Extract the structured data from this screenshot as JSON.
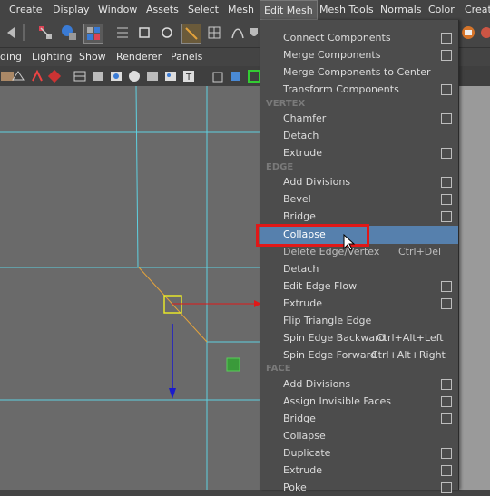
{
  "menubar": {
    "items": [
      {
        "label": "Create"
      },
      {
        "label": "Display"
      },
      {
        "label": "Window"
      },
      {
        "label": "Assets"
      },
      {
        "label": "Select"
      },
      {
        "label": "Mesh"
      },
      {
        "label": "Edit Mesh"
      },
      {
        "label": "Mesh Tools"
      },
      {
        "label": "Normals"
      },
      {
        "label": "Color"
      },
      {
        "label": "Creat"
      }
    ]
  },
  "panel_menu": {
    "items": [
      {
        "label": "ding"
      },
      {
        "label": "Lighting"
      },
      {
        "label": "Show"
      },
      {
        "label": "Renderer"
      },
      {
        "label": "Panels"
      }
    ]
  },
  "dropdown": {
    "top_items": [
      {
        "label": "Connect Components",
        "box": true
      },
      {
        "label": "Merge Components",
        "box": true
      },
      {
        "label": "Merge Components to Center",
        "box": false
      },
      {
        "label": "Transform Components",
        "box": true
      }
    ],
    "sections": {
      "vertex": "VERTEX",
      "edge": "EDGE",
      "face": "FACE"
    },
    "vertex_items": [
      {
        "label": "Chamfer",
        "box": true
      },
      {
        "label": "Detach",
        "box": false
      },
      {
        "label": "Extrude",
        "box": true
      }
    ],
    "edge_items": [
      {
        "label": "Add Divisions",
        "box": true
      },
      {
        "label": "Bevel",
        "box": true
      },
      {
        "label": "Bridge",
        "box": true
      },
      {
        "label": "Collapse",
        "box": false,
        "highlighted": true
      },
      {
        "label": "Delete Edge/Vertex",
        "shortcut": "Ctrl+Del",
        "box": false
      },
      {
        "label": "Detach",
        "box": false
      },
      {
        "label": "Edit Edge Flow",
        "box": true
      },
      {
        "label": "Extrude",
        "box": true
      },
      {
        "label": "Flip Triangle Edge",
        "box": false
      },
      {
        "label": "Spin Edge Backward",
        "shortcut": "Ctrl+Alt+Left",
        "box": false
      },
      {
        "label": "Spin Edge Forward",
        "shortcut": "Ctrl+Alt+Right",
        "box": false
      }
    ],
    "face_items": [
      {
        "label": "Add Divisions",
        "box": true
      },
      {
        "label": "Assign Invisible Faces",
        "box": true
      },
      {
        "label": "Bridge",
        "box": true
      },
      {
        "label": "Collapse",
        "box": false
      },
      {
        "label": "Duplicate",
        "box": true
      },
      {
        "label": "Extrude",
        "box": true
      },
      {
        "label": "Poke",
        "box": true
      }
    ]
  },
  "colors": {
    "highlight": "#5680ad",
    "annotation_outline": "#e01818",
    "wire": "#5fd0e0",
    "manip_x": "#e01818",
    "manip_y": "#1a1acc",
    "selected_vertex": "#e6e62a"
  },
  "icons": {
    "toolbar": [
      "select-tool-icon",
      "lasso-tool-icon",
      "paint-select-icon",
      "move-tool-icon",
      "magnet-snap-icon",
      "edge-snap-icon",
      "vertex-snap-icon",
      "curve-tool-icon"
    ],
    "render": [
      "render-icon",
      "settings-icon"
    ]
  }
}
